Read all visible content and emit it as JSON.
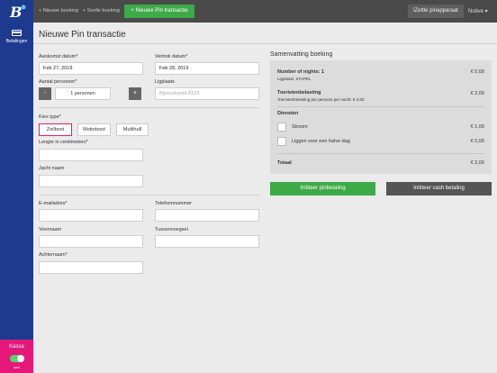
{
  "sidebar": {
    "logo_letter": "B",
    "nav_items": [
      {
        "label": "Betalingen",
        "icon": "credit-card-icon"
      }
    ],
    "kassa_label": "Kassa",
    "toggle_text": "aan",
    "toggle_on": true
  },
  "topbar": {
    "crumbs": [
      "+ Nieuwe boeking",
      "+ Snelle boeking"
    ],
    "new_pin_label": "+ Nieuwe Pin transactie",
    "izettle_label": "iZettle pinapparaat",
    "user_menu_label": "Notive ▾"
  },
  "page": {
    "title": "Nieuwe Pin transactie"
  },
  "form": {
    "arrival_label": "Aankomst datum*",
    "arrival_value": "Feb 27, 2019",
    "departure_label": "Vertrek datum*",
    "departure_value": "Feb 28, 2019",
    "persons_label": "Aantal personen*",
    "persons_minus": "-",
    "persons_value": "1 personen",
    "persons_plus": "+",
    "ligplaats_label": "Ligplaats",
    "ligplaats_placeholder": "Bijvoorbeeld A133",
    "type_label": "Kies type*",
    "types": [
      "Zeilboot",
      "Motorboot",
      "Multihull"
    ],
    "type_selected": "Zeilboot",
    "length_label": "Lengte in centimeters*",
    "length_value": "",
    "jacht_label": "Jacht naam",
    "jacht_value": "",
    "email_label": "E-mailadres*",
    "email_value": "",
    "phone_label": "Telefoonnummer",
    "phone_value": "",
    "firstname_label": "Voornaam",
    "firstname_value": "",
    "middle_label": "Tussenvoegsel",
    "middle_value": "",
    "lastname_label": "Achternaam*",
    "lastname_value": ""
  },
  "summary": {
    "title": "Samenvatting boeking",
    "nights_label": "Number of nights: 1",
    "nights_sub": "Ligplaats: STAPEL",
    "nights_price": "€ 0,00",
    "tax_label": "Toeristenbelasting",
    "tax_sub": "Toeristenbelasting per persoon per nacht: € 2,00",
    "tax_price": "€ 2,00",
    "services_label": "Diensten",
    "services": [
      {
        "label": "Stroom",
        "price": "€ 1,00",
        "checked": false
      },
      {
        "label": "Liggen voor een halve dag",
        "price": "€ 0,00",
        "checked": false
      }
    ],
    "total_label": "Totaal",
    "total_price": "€ 2,00"
  },
  "actions": {
    "pin_label": "Inititeer pinbetaling",
    "cash_label": "Inititeer cash betaling"
  },
  "colors": {
    "sidebar": "#1d3a8f",
    "accent_green": "#3daa47",
    "accent_pink": "#e5187a",
    "topbar": "#4a4a4a"
  }
}
